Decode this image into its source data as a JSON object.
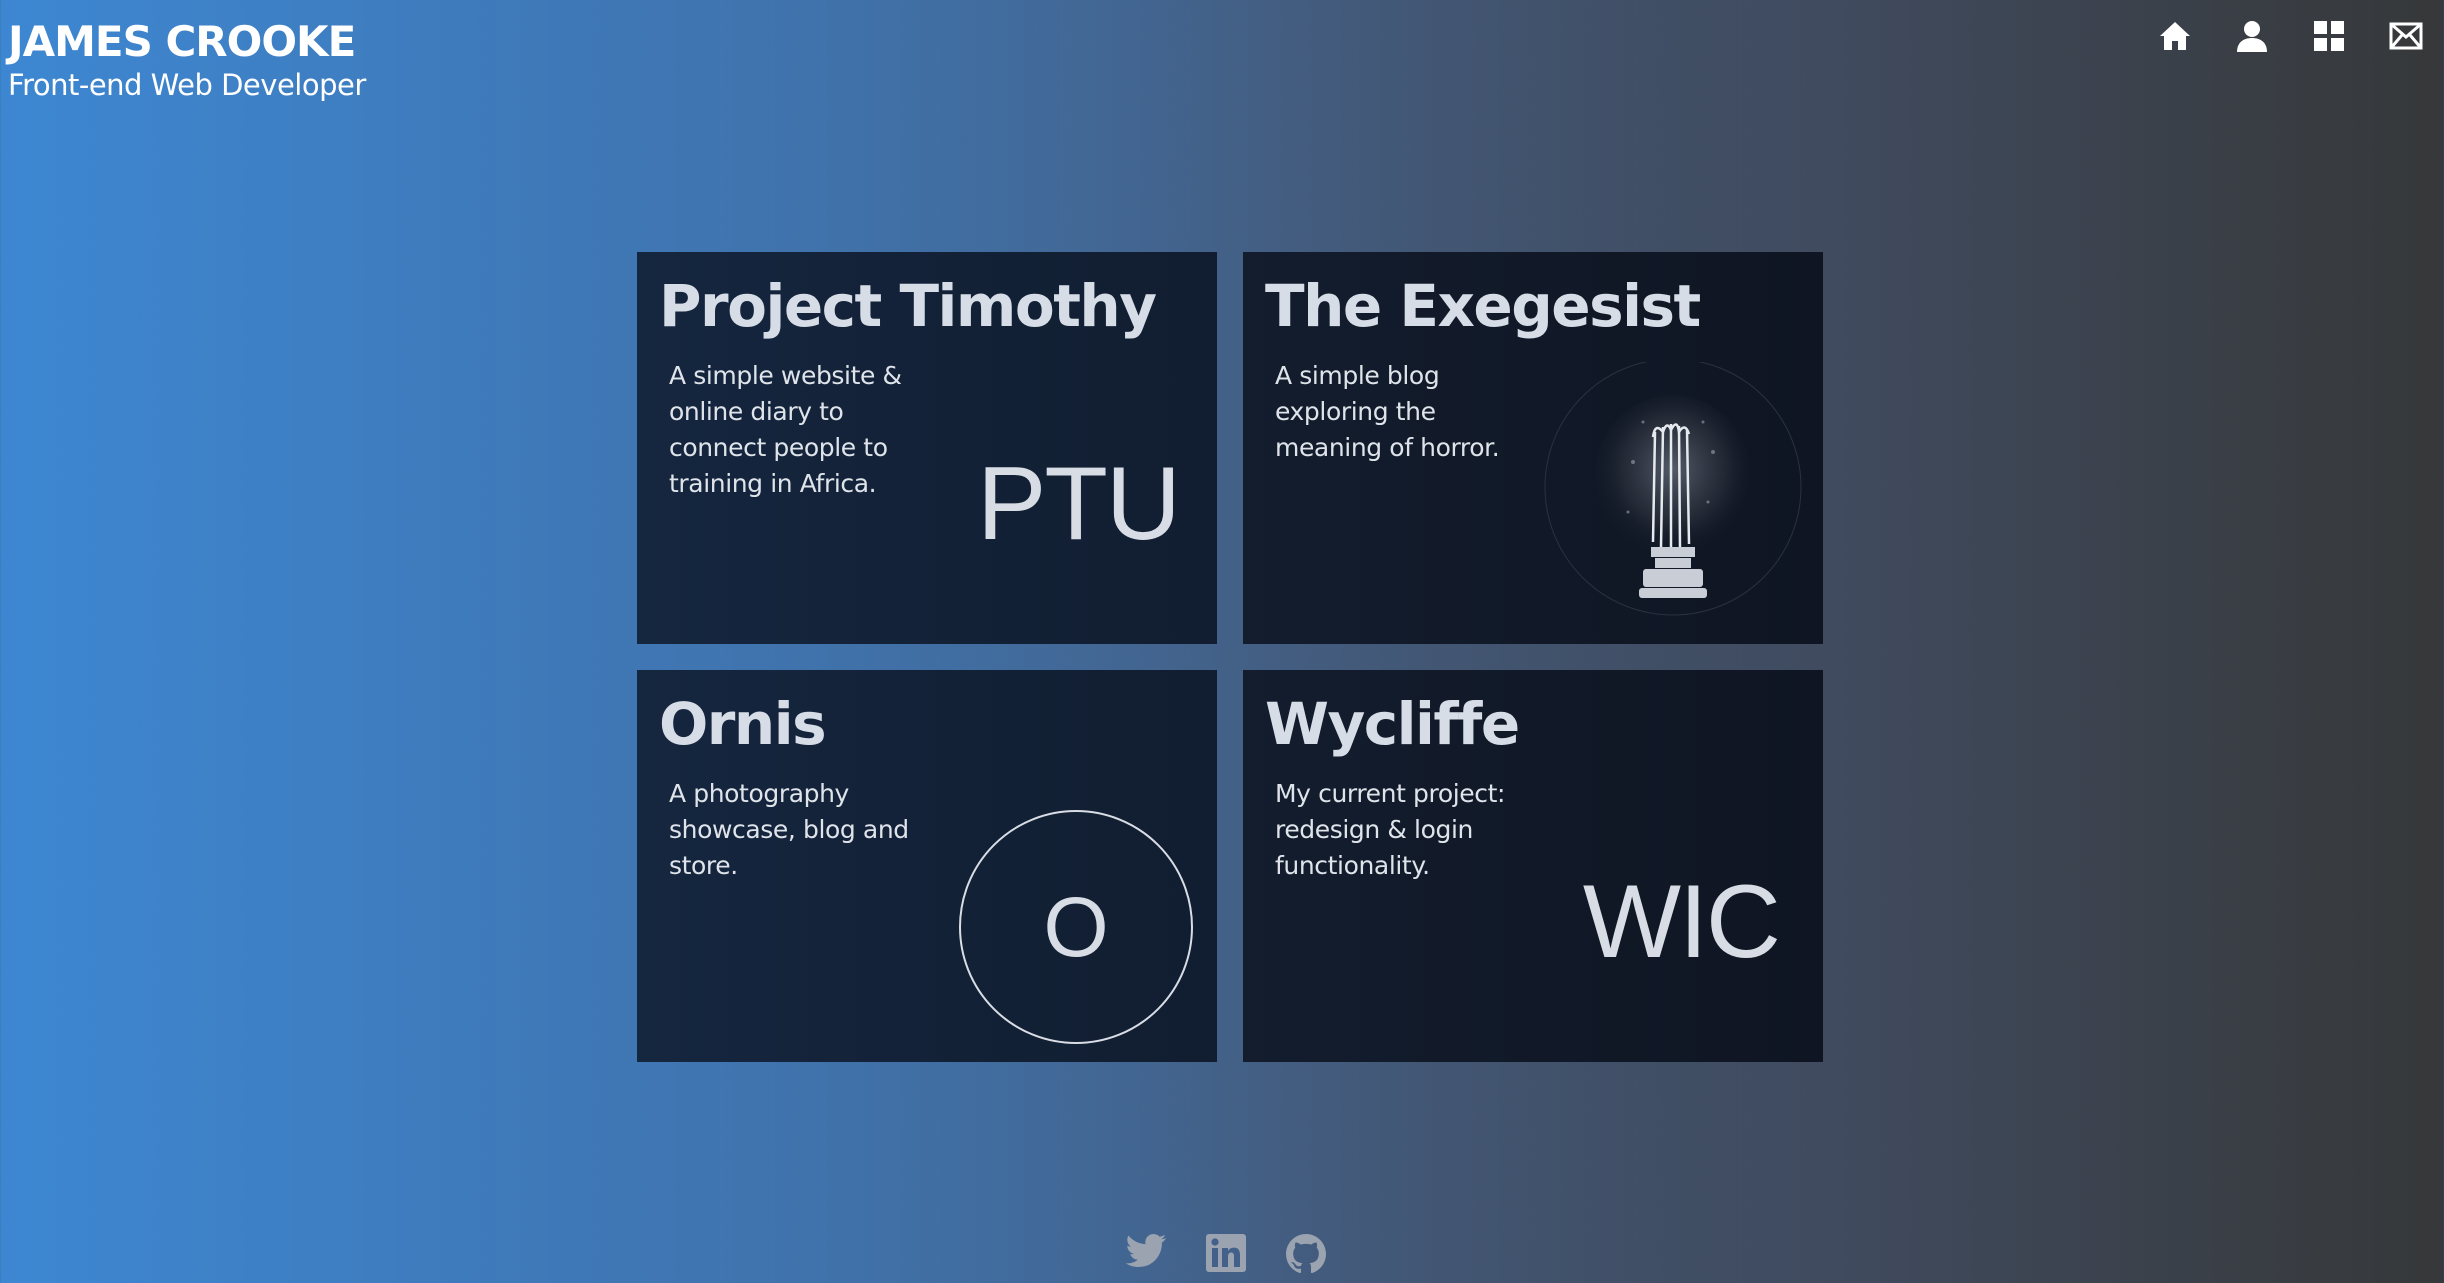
{
  "header": {
    "name": "JAMES CROOKE",
    "role": "Front-end Web Developer"
  },
  "nav": [
    {
      "icon": "home-icon"
    },
    {
      "icon": "user-icon"
    },
    {
      "icon": "grid-icon"
    },
    {
      "icon": "mail-icon"
    }
  ],
  "projects": [
    {
      "title": "Project Timothy",
      "description": "A simple website & online diary to connect people to training in Africa.",
      "logo": "PTU"
    },
    {
      "title": "The Exegesist",
      "description": "A simple blog exploring the meaning of horror.",
      "logo_icon": "lightbulb-icon"
    },
    {
      "title": "Ornis",
      "description": "A photography showcase, blog and store.",
      "logo": "O"
    },
    {
      "title": "Wycliffe",
      "description": "My current project: redesign & login functionality.",
      "logo": "WIC"
    }
  ],
  "social": [
    {
      "icon": "twitter-icon"
    },
    {
      "icon": "linkedin-icon"
    },
    {
      "icon": "github-icon"
    }
  ],
  "colors": {
    "gradient_left": "#3d87d2",
    "gradient_right": "#363839",
    "card_bg": "#132238",
    "card_text": "#d6dde7"
  }
}
